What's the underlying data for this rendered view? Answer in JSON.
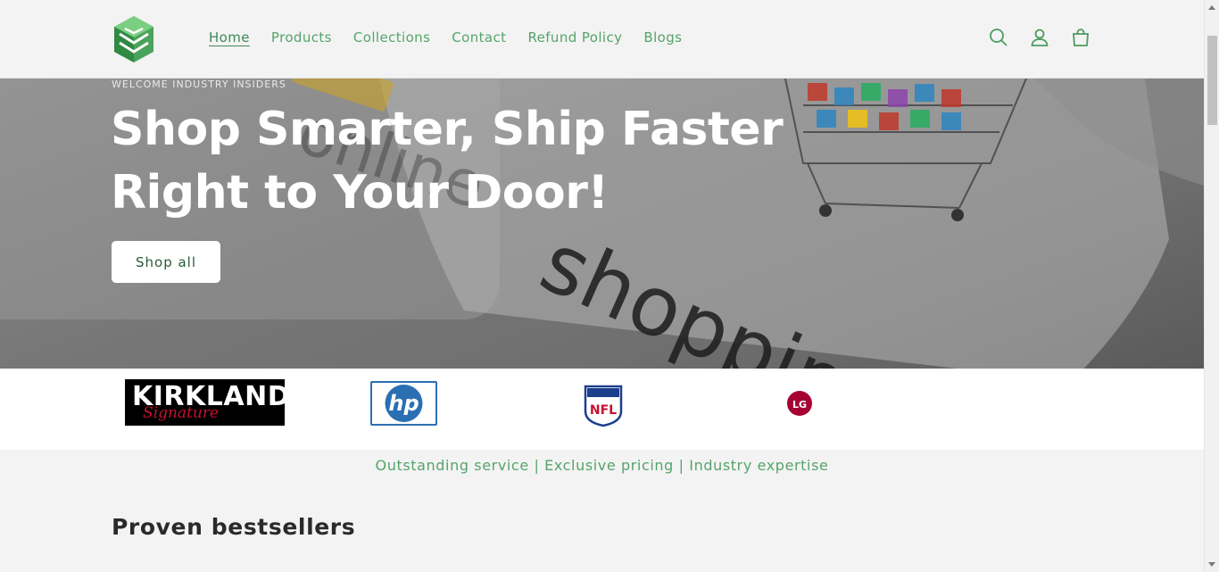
{
  "header": {
    "logo_name": "store-logo",
    "nav": [
      {
        "label": "Home",
        "active": true
      },
      {
        "label": "Products",
        "active": false
      },
      {
        "label": "Collections",
        "active": false
      },
      {
        "label": "Contact",
        "active": false
      },
      {
        "label": "Refund Policy",
        "active": false
      },
      {
        "label": "Blogs",
        "active": false
      }
    ],
    "icons": [
      "search-icon",
      "account-icon",
      "cart-icon"
    ]
  },
  "hero": {
    "eyebrow": "WELCOME INDUSTRY INSIDERS",
    "title_line1": "Shop Smarter, Ship Faster",
    "title_line2": "Right to Your Door!",
    "button_label": "Shop all"
  },
  "brands": {
    "kirkland_line1": "KIRKLAND",
    "kirkland_line2": "Signature",
    "hp": "hp",
    "nfl": "NFL",
    "lg": "LG"
  },
  "tagline": "Outstanding service | Exclusive pricing | Industry expertise",
  "section_title": "Proven bestsellers",
  "colors": {
    "accent_green": "#55a46a",
    "header_bg": "#f3f3f3",
    "hero_overlay": "#6f6f6f"
  }
}
